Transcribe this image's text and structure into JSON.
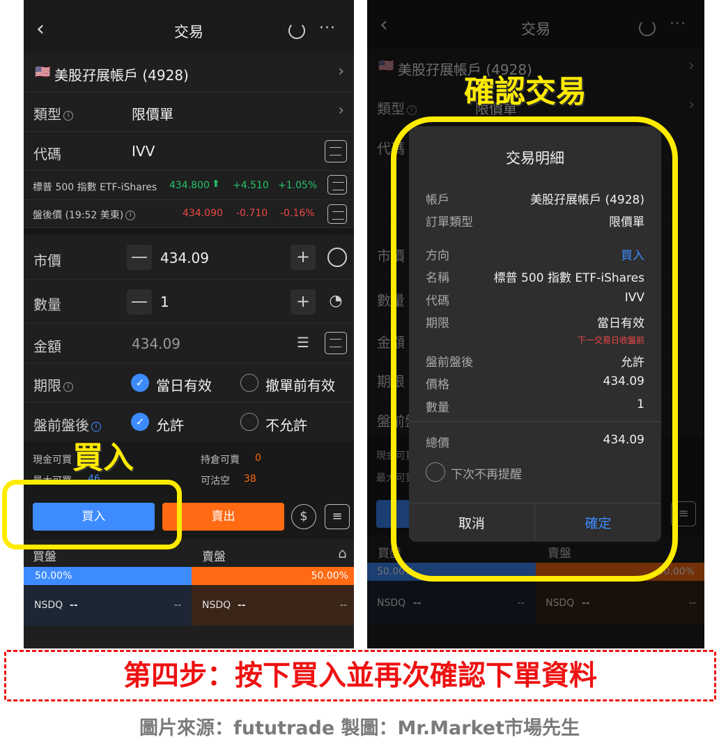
{
  "nav": {
    "title": "交易"
  },
  "account": {
    "name": "美股孖展帳戶 (4928)"
  },
  "order_type": {
    "label": "類型",
    "value": "限價單"
  },
  "symbol": {
    "label": "代碼",
    "value": "IVV"
  },
  "quote": {
    "name": "標普 500 指數 ETF-iShares",
    "price": "434.800",
    "change": "+4.510",
    "pct": "+1.05%"
  },
  "after_hours": {
    "label": "盤後價 (19:52 美東)",
    "price": "434.090",
    "change": "-0.710",
    "pct": "-0.16%"
  },
  "price_field": {
    "label": "市價",
    "value": "434.09"
  },
  "qty_field": {
    "label": "數量",
    "value": "1"
  },
  "amount_field": {
    "label": "金額",
    "value": "434.09"
  },
  "validity": {
    "label": "期限",
    "opt1": "當日有效",
    "opt2": "撤單前有效"
  },
  "extended": {
    "label": "盤前盤後",
    "opt1": "允許",
    "opt2": "不允許"
  },
  "funds": {
    "cash_label": "現金可買",
    "max_label": "最大可買",
    "max_value": "46",
    "hold_label": "持倉可賣",
    "hold_value": "0",
    "short_label": "可沽空",
    "short_value": "38"
  },
  "actions": {
    "buy": "買入",
    "sell": "賣出"
  },
  "book": {
    "bid_label": "買盤",
    "ask_label": "賣盤",
    "bid_pct": "50.00%",
    "ask_pct": "50.00%",
    "exchange": "NSDQ",
    "dash": "--"
  },
  "dialog": {
    "title": "交易明細",
    "rows": [
      {
        "label": "帳戶",
        "value": "美股孖展帳戶 (4928)"
      },
      {
        "label": "訂單類型",
        "value": "限價單"
      },
      {
        "label": "方向",
        "value": "買入"
      },
      {
        "label": "名稱",
        "value": "標普 500 指數 ETF-iShares"
      },
      {
        "label": "代碼",
        "value": "IVV"
      },
      {
        "label": "期限",
        "value": "當日有效"
      },
      {
        "label": "盤前盤後",
        "value": "允許"
      },
      {
        "label": "價格",
        "value": "434.09"
      },
      {
        "label": "數量",
        "value": "1"
      },
      {
        "label": "總價",
        "value": "434.09"
      }
    ],
    "expiry_note": "下一交易日收盤前",
    "dont_remind": "下次不再提醒",
    "cancel": "取消",
    "confirm": "確定"
  },
  "annotations": {
    "buy_callout": "買入",
    "confirm_callout": "確認交易",
    "step_banner": "第四步：按下買入並再次確認下單資料",
    "credit": "圖片來源：fututrade  製圖：Mr.Market市場先生"
  },
  "colors": {
    "accent_blue": "#3d8bff",
    "sell_orange": "#ff6a13",
    "highlight_yellow": "#ffeb00",
    "banner_red": "#e11111"
  }
}
